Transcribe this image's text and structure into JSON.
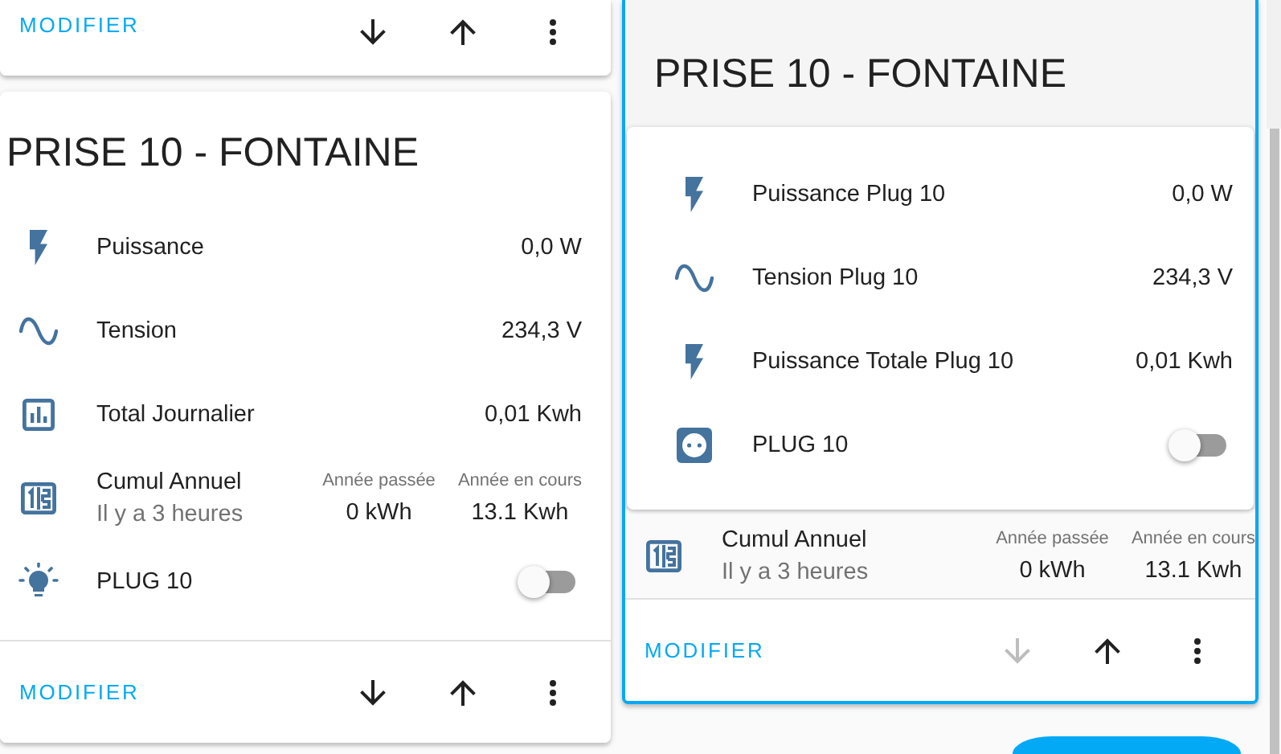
{
  "left_column": {
    "partial_card": {
      "selected": false,
      "footer": {
        "edit": "MODIFIER",
        "move_down": {
          "disabled": false
        },
        "move_up": {
          "disabled": false
        }
      }
    },
    "card": {
      "selected": false,
      "title": "PRISE 10 - FONTAINE",
      "rows": [
        {
          "kind": "sensor",
          "name": "Puissance",
          "value": "0,0 W"
        },
        {
          "kind": "sensor",
          "name": "Tension",
          "value": "234,3 V"
        },
        {
          "kind": "sensor",
          "name": "Total Journalier",
          "value": "0,01 Kwh"
        },
        {
          "kind": "attributes",
          "name": "Cumul Annuel",
          "secondary": "Il y a 3 heures",
          "attributes": [
            {
              "label": "Année passée",
              "value": "0 kWh"
            },
            {
              "label": "Année en cours",
              "value": "13.1 Kwh"
            }
          ]
        },
        {
          "kind": "toggle",
          "name": "PLUG 10",
          "on": false
        }
      ],
      "footer": {
        "edit": "MODIFIER",
        "move_down": {
          "disabled": false
        },
        "move_up": {
          "disabled": false
        }
      }
    }
  },
  "right_column": {
    "card": {
      "selected": true,
      "title": "PRISE 10 - FONTAINE",
      "rows": [
        {
          "kind": "sensor",
          "name": "Puissance Plug 10",
          "value": "0,0 W"
        },
        {
          "kind": "sensor",
          "name": "Tension Plug 10",
          "value": "234,3 V"
        },
        {
          "kind": "sensor",
          "name": "Puissance Totale Plug 10",
          "value": "0,01 Kwh"
        },
        {
          "kind": "toggle",
          "name": "PLUG 10",
          "on": false
        }
      ],
      "attribute_row": {
        "kind": "attributes",
        "name": "Cumul Annuel",
        "secondary": "Il y a 3 heures",
        "attributes": [
          {
            "label": "Année passée",
            "value": "0 kWh"
          },
          {
            "label": "Année en cours",
            "value": "13.1 Kwh"
          }
        ]
      },
      "footer": {
        "edit": "MODIFIER",
        "move_down": {
          "disabled": true
        },
        "move_up": {
          "disabled": false
        }
      }
    }
  }
}
